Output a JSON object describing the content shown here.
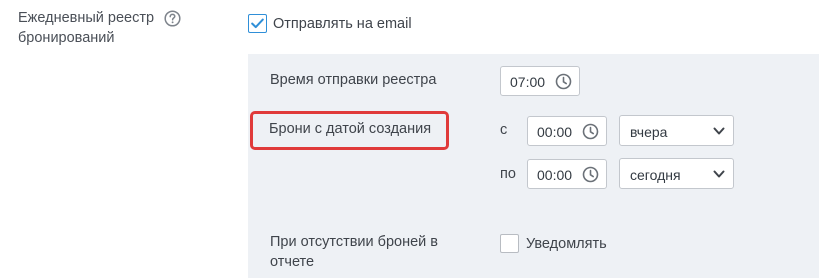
{
  "section": {
    "label": "Ежедневный реестр бронирований",
    "help_icon": "question-circle-icon",
    "send_email": {
      "label": "Отправлять на email",
      "checked": true
    }
  },
  "panel": {
    "send_time": {
      "label": "Время отправки реестра",
      "value": "07:00",
      "icon": "clock-icon"
    },
    "bookings_created": {
      "label": "Брони с датой создания",
      "from": {
        "prefix": "с",
        "time": "00:00",
        "day": "вчера"
      },
      "to": {
        "prefix": "по",
        "time": "00:00",
        "day": "сегодня"
      }
    },
    "no_bookings": {
      "label": "При отсутствии броней в отчете",
      "checkbox_label": "Уведомлять",
      "checked": false
    }
  },
  "colors": {
    "accent": "#2f8fd8",
    "highlight": "#e03a3a",
    "panel_bg": "#eef1f5"
  }
}
